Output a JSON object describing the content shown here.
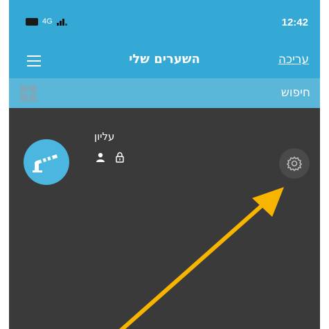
{
  "status_bar": {
    "network": "4G",
    "time": "12:42"
  },
  "app_bar": {
    "title": "השערים שלי",
    "edit_label": "עריכה"
  },
  "search": {
    "label": "חיפוש"
  },
  "gates": [
    {
      "name": "עליון"
    }
  ],
  "colors": {
    "header": "#35a9d6",
    "search_bar": "#5bb7da",
    "background": "#3a3a3a",
    "avatar": "#4bb6e0",
    "annotation_arrow": "#f7b500"
  },
  "icons": [
    "menu-icon",
    "grid-icon",
    "gate-barrier-icon",
    "person-icon",
    "lock-icon",
    "gear-icon",
    "annotation-arrow"
  ]
}
